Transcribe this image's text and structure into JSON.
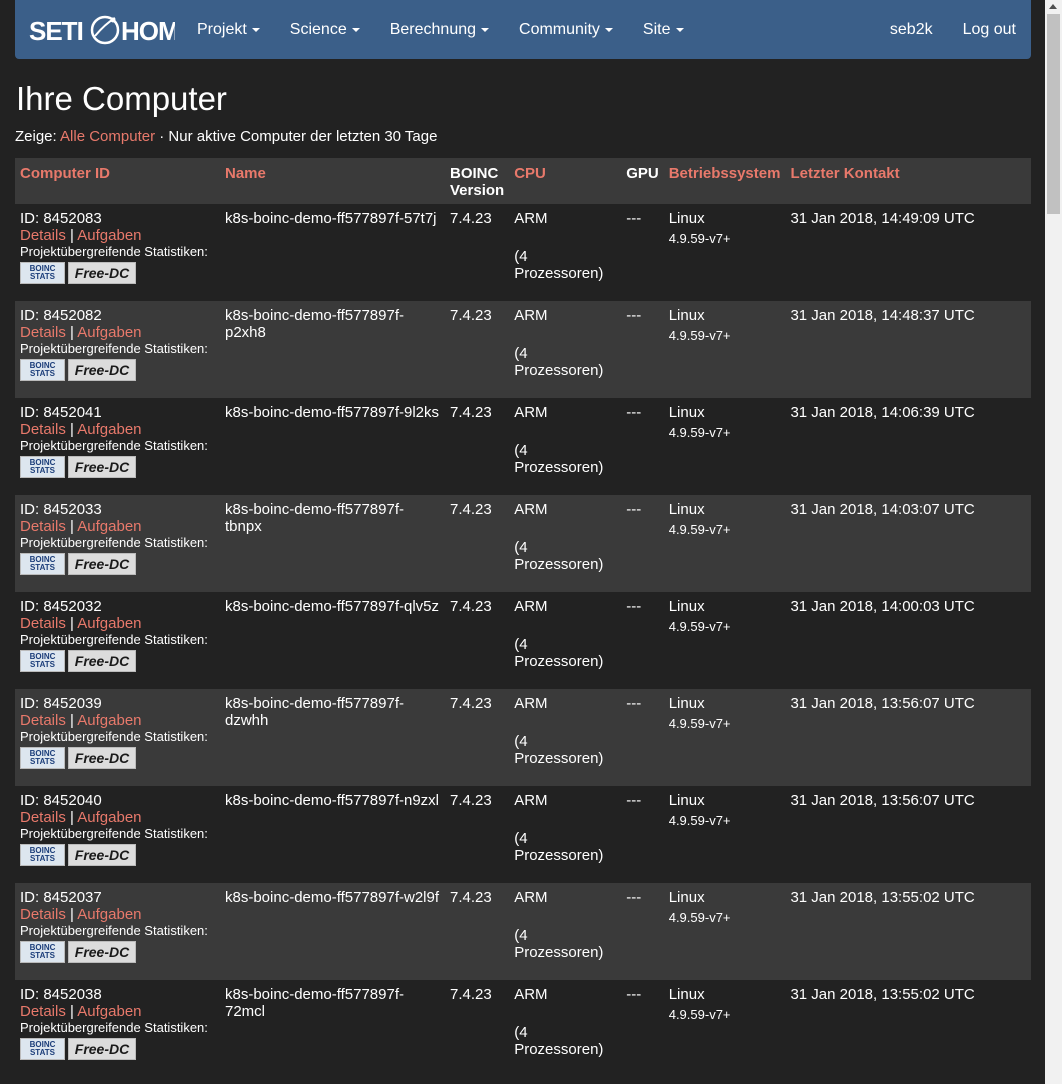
{
  "nav": {
    "logo": "SETI@HOME",
    "items": [
      "Projekt",
      "Science",
      "Berechnung",
      "Community",
      "Site"
    ],
    "user": "seb2k",
    "logout": "Log out"
  },
  "page": {
    "title": "Ihre Computer",
    "filter_prefix": "Zeige: ",
    "filter_link": "Alle Computer",
    "filter_suffix": " · Nur aktive Computer der letzten 30 Tage"
  },
  "table": {
    "headers": {
      "id": "Computer ID",
      "name": "Name",
      "version_a": "BOINC",
      "version_b": "Version",
      "cpu": "CPU",
      "gpu": "GPU",
      "os": "Betriebssystem",
      "contact": "Letzter Kontakt"
    },
    "labels": {
      "details": "Details",
      "tasks": "Aufgaben",
      "sep": "|",
      "stats": "Projektübergreifende Statistiken:",
      "boinc_a": "BOINC",
      "boinc_b": "STATS",
      "freedc": "Free-DC"
    },
    "rows": [
      {
        "id": "ID: 8452083",
        "name": "k8s-boinc-demo-ff577897f-57t7j",
        "version": "7.4.23",
        "cpu": "ARM",
        "procs": "(4 Prozessoren)",
        "gpu": "---",
        "os": "Linux",
        "kernel": "4.9.59-v7+",
        "contact": "31 Jan 2018, 14:49:09 UTC"
      },
      {
        "id": "ID: 8452082",
        "name": "k8s-boinc-demo-ff577897f-p2xh8",
        "version": "7.4.23",
        "cpu": "ARM",
        "procs": "(4 Prozessoren)",
        "gpu": "---",
        "os": "Linux",
        "kernel": "4.9.59-v7+",
        "contact": "31 Jan 2018, 14:48:37 UTC"
      },
      {
        "id": "ID: 8452041",
        "name": "k8s-boinc-demo-ff577897f-9l2ks",
        "version": "7.4.23",
        "cpu": "ARM",
        "procs": "(4 Prozessoren)",
        "gpu": "---",
        "os": "Linux",
        "kernel": "4.9.59-v7+",
        "contact": "31 Jan 2018, 14:06:39 UTC"
      },
      {
        "id": "ID: 8452033",
        "name": "k8s-boinc-demo-ff577897f-tbnpx",
        "version": "7.4.23",
        "cpu": "ARM",
        "procs": "(4 Prozessoren)",
        "gpu": "---",
        "os": "Linux",
        "kernel": "4.9.59-v7+",
        "contact": "31 Jan 2018, 14:03:07 UTC"
      },
      {
        "id": "ID: 8452032",
        "name": "k8s-boinc-demo-ff577897f-qlv5z",
        "version": "7.4.23",
        "cpu": "ARM",
        "procs": "(4 Prozessoren)",
        "gpu": "---",
        "os": "Linux",
        "kernel": "4.9.59-v7+",
        "contact": "31 Jan 2018, 14:00:03 UTC"
      },
      {
        "id": "ID: 8452039",
        "name": "k8s-boinc-demo-ff577897f-dzwhh",
        "version": "7.4.23",
        "cpu": "ARM",
        "procs": "(4 Prozessoren)",
        "gpu": "---",
        "os": "Linux",
        "kernel": "4.9.59-v7+",
        "contact": "31 Jan 2018, 13:56:07 UTC"
      },
      {
        "id": "ID: 8452040",
        "name": "k8s-boinc-demo-ff577897f-n9zxl",
        "version": "7.4.23",
        "cpu": "ARM",
        "procs": "(4 Prozessoren)",
        "gpu": "---",
        "os": "Linux",
        "kernel": "4.9.59-v7+",
        "contact": "31 Jan 2018, 13:56:07 UTC"
      },
      {
        "id": "ID: 8452037",
        "name": "k8s-boinc-demo-ff577897f-w2l9f",
        "version": "7.4.23",
        "cpu": "ARM",
        "procs": "(4 Prozessoren)",
        "gpu": "---",
        "os": "Linux",
        "kernel": "4.9.59-v7+",
        "contact": "31 Jan 2018, 13:55:02 UTC"
      },
      {
        "id": "ID: 8452038",
        "name": "k8s-boinc-demo-ff577897f-72mcl",
        "version": "7.4.23",
        "cpu": "ARM",
        "procs": "(4 Prozessoren)",
        "gpu": "---",
        "os": "Linux",
        "kernel": "4.9.59-v7+",
        "contact": "31 Jan 2018, 13:55:02 UTC"
      }
    ]
  },
  "colors": {
    "navbar": "#3b5f89",
    "link": "#e8796b",
    "background": "#222222",
    "row_alt": "#3a3a3a"
  }
}
